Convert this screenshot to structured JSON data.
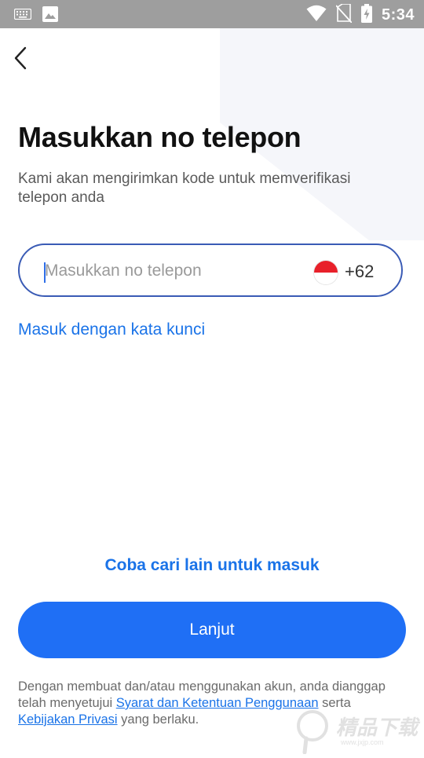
{
  "status_bar": {
    "time": "5:34",
    "icons": [
      "keyboard-icon",
      "image-icon",
      "wifi-icon",
      "no-sim-icon",
      "battery-charging-icon"
    ],
    "bg_color": "#9e9e9e"
  },
  "header": {
    "back_icon": "chevron-left-icon"
  },
  "page": {
    "title": "Masukkan no telepon",
    "subtitle": "Kami akan mengirimkan kode untuk memverifikasi telepon anda"
  },
  "phone_field": {
    "placeholder": "Masukkan no telepon",
    "value": "",
    "country_flag": "indonesia-flag-icon",
    "country_code": "+62"
  },
  "links": {
    "password_login": "Masuk dengan kata kunci",
    "alt_login": "Coba cari lain untuk masuk"
  },
  "primary_button": {
    "label": "Lanjut",
    "color": "#1f6ff5"
  },
  "terms": {
    "prefix": "Dengan membuat dan/atau menggunakan akun, anda dianggap telah menyetujui ",
    "terms_link": "Syarat dan Ketentuan Penggunaan",
    "middle": " serta ",
    "privacy_link": "Kebijakan Privasi",
    "suffix": " yang berlaku."
  },
  "watermark": {
    "text": "精品下载",
    "url": "www.jxjp.com"
  },
  "colors": {
    "accent": "#1a73e8",
    "input_border": "#3a5bb5",
    "title": "#111111"
  }
}
